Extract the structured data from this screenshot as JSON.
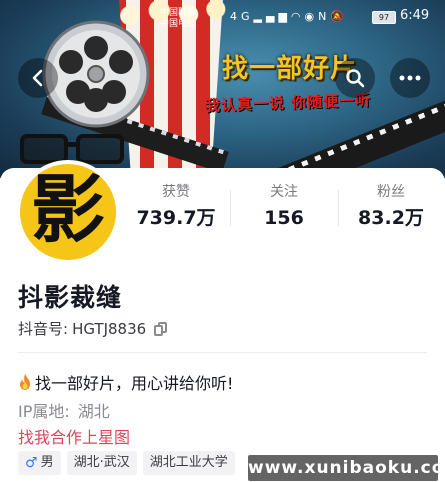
{
  "status_bar": {
    "carrier_line1": "中国联通",
    "carrier_line2": "中国电信",
    "network": "4G",
    "battery": "97",
    "time": "6:49"
  },
  "banner": {
    "title": "找一部好片",
    "subtitle": "我认真一说 你随便一听"
  },
  "profile": {
    "avatar_text": "影",
    "name": "抖影裁缝",
    "id_label": "抖音号:",
    "id_value": "HGTJ8836",
    "stats": [
      {
        "label": "获赞",
        "value": "739.7万"
      },
      {
        "label": "关注",
        "value": "156"
      },
      {
        "label": "粉丝",
        "value": "83.2万"
      }
    ],
    "bio": "找一部好片，用心讲给你听!",
    "ip_label": "IP属地:",
    "ip_value": "湖北",
    "collab_link": "找我合作上星图",
    "tags": [
      "男",
      "湖北·武汉",
      "湖北工业大学"
    ]
  },
  "watermark": "www.xunibaoku.com",
  "colors": {
    "link": "#e0445a",
    "avatar_bg": "#f5c518",
    "banner_title": "#f5c623",
    "male": "#2f7cf6"
  },
  "icons": [
    "back-arrow-icon",
    "search-icon",
    "more-dots-icon",
    "copy-icon",
    "fire-icon",
    "male-icon"
  ]
}
